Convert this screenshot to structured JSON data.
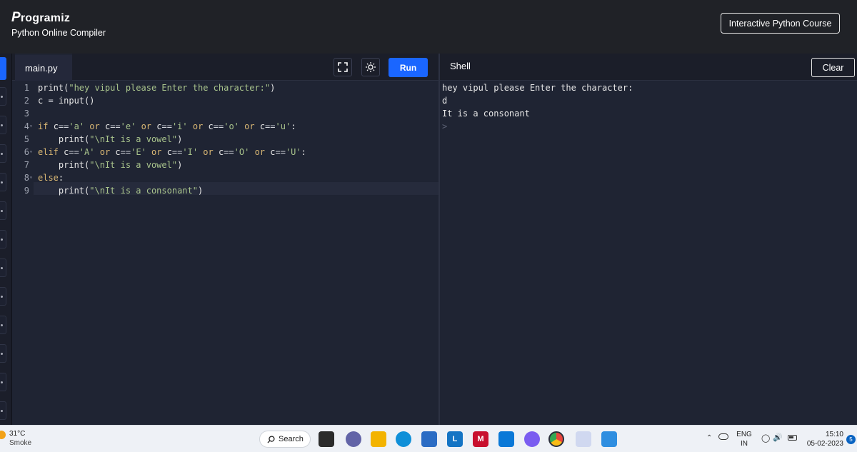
{
  "header": {
    "logo_text": "rogramiz",
    "logo_p": "P",
    "subtitle": "Python Online Compiler",
    "course_button": "Interactive Python Course"
  },
  "editor": {
    "tab_label": "main.py",
    "run_label": "Run",
    "lines": [
      {
        "n": "1",
        "parts": [
          [
            "fn",
            "print("
          ],
          [
            "str",
            "\"hey vipul please Enter the character:\""
          ],
          [
            "fn",
            ")"
          ]
        ]
      },
      {
        "n": "2",
        "parts": [
          [
            "fn",
            "c "
          ],
          [
            "op",
            "= "
          ],
          [
            "fn",
            "input()"
          ]
        ]
      },
      {
        "n": "3",
        "parts": []
      },
      {
        "n": "4",
        "fold": true,
        "parts": [
          [
            "kw",
            "if "
          ],
          [
            "fn",
            "c"
          ],
          [
            "op",
            "=="
          ],
          [
            "str",
            "'a'"
          ],
          [
            "kw",
            " or "
          ],
          [
            "fn",
            "c"
          ],
          [
            "op",
            "=="
          ],
          [
            "str",
            "'e'"
          ],
          [
            "kw",
            " or "
          ],
          [
            "fn",
            "c"
          ],
          [
            "op",
            "=="
          ],
          [
            "str",
            "'i'"
          ],
          [
            "kw",
            " or "
          ],
          [
            "fn",
            "c"
          ],
          [
            "op",
            "=="
          ],
          [
            "str",
            "'o'"
          ],
          [
            "kw",
            " or "
          ],
          [
            "fn",
            "c"
          ],
          [
            "op",
            "=="
          ],
          [
            "str",
            "'u'"
          ],
          [
            "fn",
            ":"
          ]
        ]
      },
      {
        "n": "5",
        "parts": [
          [
            "fn",
            "    print("
          ],
          [
            "str",
            "\"\\nIt is a vowel\""
          ],
          [
            "fn",
            ")"
          ]
        ]
      },
      {
        "n": "6",
        "fold": true,
        "parts": [
          [
            "kw",
            "elif "
          ],
          [
            "fn",
            "c"
          ],
          [
            "op",
            "=="
          ],
          [
            "str",
            "'A'"
          ],
          [
            "kw",
            " or "
          ],
          [
            "fn",
            "c"
          ],
          [
            "op",
            "=="
          ],
          [
            "str",
            "'E'"
          ],
          [
            "kw",
            " or "
          ],
          [
            "fn",
            "c"
          ],
          [
            "op",
            "=="
          ],
          [
            "str",
            "'I'"
          ],
          [
            "kw",
            " or "
          ],
          [
            "fn",
            "c"
          ],
          [
            "op",
            "=="
          ],
          [
            "str",
            "'O'"
          ],
          [
            "kw",
            " or "
          ],
          [
            "fn",
            "c"
          ],
          [
            "op",
            "=="
          ],
          [
            "str",
            "'U'"
          ],
          [
            "fn",
            ":"
          ]
        ]
      },
      {
        "n": "7",
        "parts": [
          [
            "fn",
            "    print("
          ],
          [
            "str",
            "\"\\nIt is a vowel\""
          ],
          [
            "fn",
            ")"
          ]
        ]
      },
      {
        "n": "8",
        "fold": true,
        "parts": [
          [
            "kw",
            "else"
          ],
          [
            "fn",
            ":"
          ]
        ]
      },
      {
        "n": "9",
        "parts": [
          [
            "fn",
            "    print("
          ],
          [
            "str",
            "\"\\nIt is a consonant\""
          ],
          [
            "fn",
            ")"
          ]
        ]
      }
    ]
  },
  "shell": {
    "title": "Shell",
    "clear_label": "Clear",
    "output": [
      "hey vipul please Enter the character:",
      "d",
      "It is a consonant"
    ],
    "prompt": ">"
  },
  "taskbar": {
    "weather_temp": "31°C",
    "weather_desc": "Smoke",
    "search_label": "Search",
    "lang_top": "ENG",
    "lang_bottom": "IN",
    "time": "15:10",
    "date": "05-02-2023",
    "notification_count": "5",
    "apps": [
      {
        "name": "task-view-icon",
        "color": "#2b2b2b",
        "glyph": ""
      },
      {
        "name": "chat-icon",
        "color": "#6264a7",
        "glyph": ""
      },
      {
        "name": "file-explorer-icon",
        "color": "#f3b300",
        "glyph": ""
      },
      {
        "name": "edge-icon",
        "color": "#0f8fd8",
        "glyph": ""
      },
      {
        "name": "store-icon",
        "color": "#2b6cc4",
        "glyph": ""
      },
      {
        "name": "lens-icon",
        "color": "#1474c4",
        "glyph": "L"
      },
      {
        "name": "mcafee-icon",
        "color": "#c8102e",
        "glyph": "M"
      },
      {
        "name": "app-blue-icon",
        "color": "#0a78d7",
        "glyph": ""
      },
      {
        "name": "copilot-icon",
        "color": "#7a5cf0",
        "glyph": ""
      },
      {
        "name": "chrome-icon",
        "color": "#e8453c",
        "glyph": ""
      },
      {
        "name": "snipping-tool-icon",
        "color": "#d0d8f0",
        "glyph": ""
      },
      {
        "name": "photos-icon",
        "color": "#2f8ee0",
        "glyph": ""
      }
    ]
  }
}
